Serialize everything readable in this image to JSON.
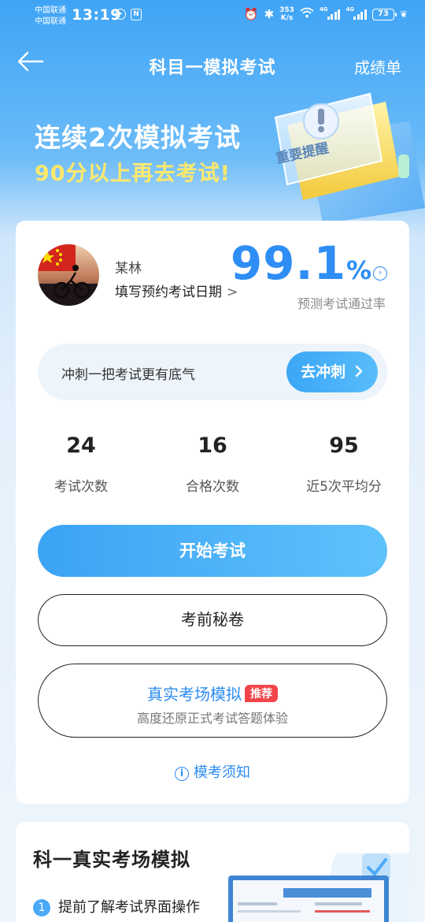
{
  "status_bar": {
    "carrier_1": "中国联通",
    "carrier_2": "中国联通",
    "time": "13:19",
    "net_speed_value": "353",
    "net_speed_unit": "K/s",
    "signal_1_tag": "4G",
    "signal_2_tag": "4G",
    "battery": "73"
  },
  "nav": {
    "title": "科目一模拟考试",
    "right_label": "成绩单"
  },
  "banner": {
    "line1": "连续2次模拟考试",
    "line2": "90分以上再去考试!",
    "badge_text": "重要提醒"
  },
  "profile": {
    "name": "某林",
    "exam_date_label": "填写预约考试日期"
  },
  "pass_rate": {
    "value": "99.1",
    "unit": "%",
    "label": "预测考试通过率"
  },
  "sprint": {
    "text": "冲刺一把考试更有底气",
    "button": "去冲刺"
  },
  "stats": [
    {
      "value": "24",
      "label": "考试次数"
    },
    {
      "value": "16",
      "label": "合格次数"
    },
    {
      "value": "95",
      "label": "近5次平均分"
    }
  ],
  "actions": {
    "start": "开始考试",
    "secret": "考前秘卷",
    "real_title": "真实考场模拟",
    "real_badge": "推荐",
    "real_sub": "高度还原正式考试答题体验",
    "notice": "模考须知"
  },
  "section2": {
    "title": "科一真实考场模拟",
    "step_num": "1",
    "step_text": "提前了解考试界面操作"
  },
  "colors": {
    "accent": "#2f8ef5",
    "banner_yellow": "#ffe96b",
    "badge_red": "#f2454a"
  }
}
